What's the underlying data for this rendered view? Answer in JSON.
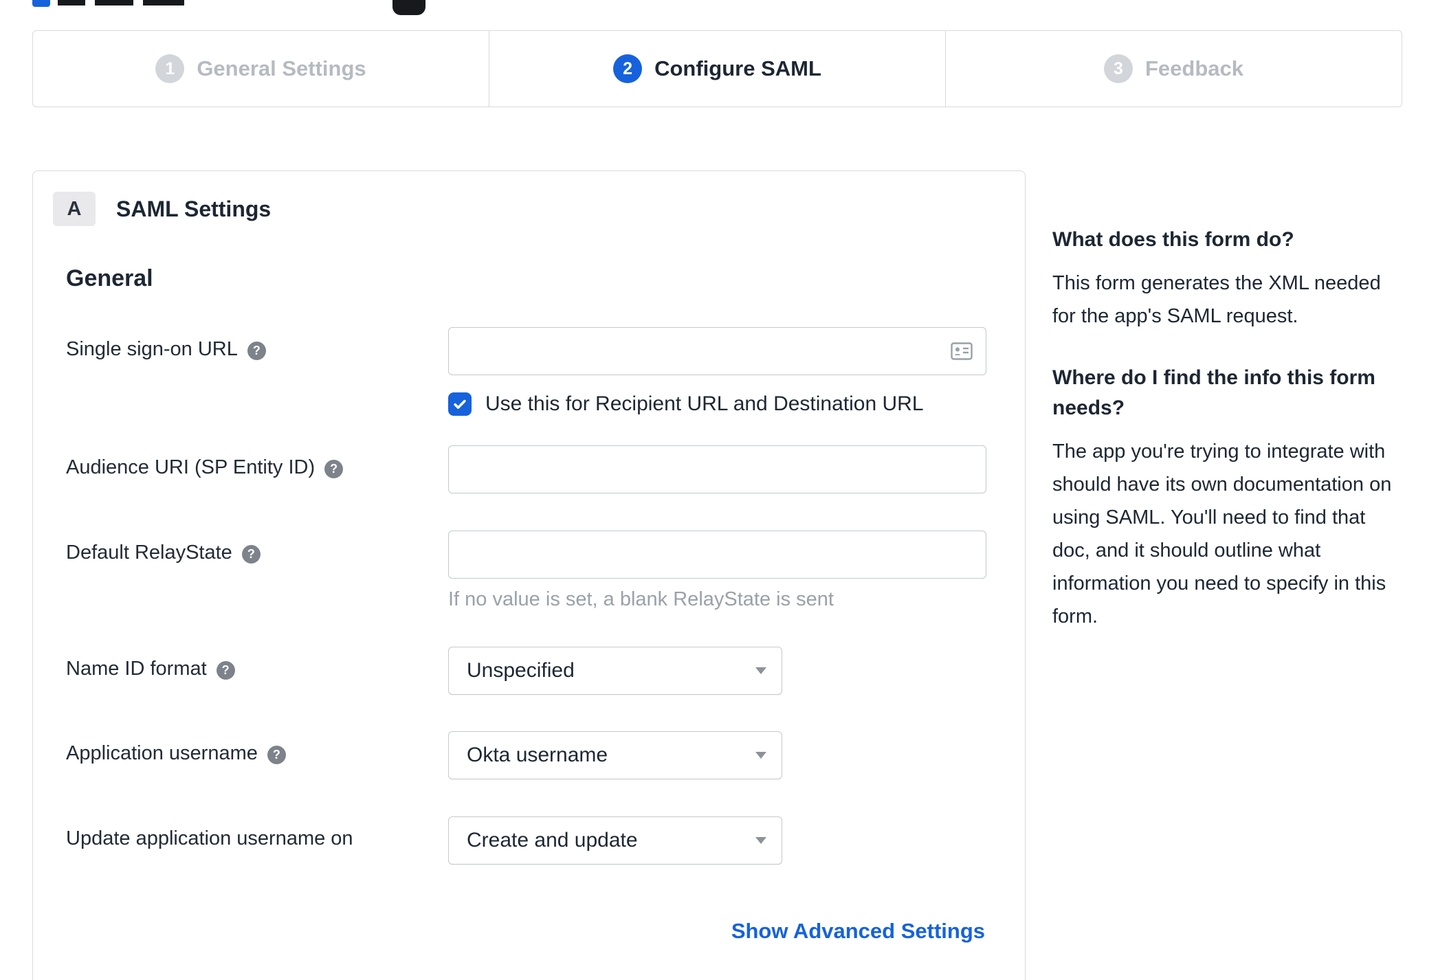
{
  "colors": {
    "accent": "#1662dd",
    "link": "#1662dd",
    "inactive_step": "#d2d5d9"
  },
  "icons": {
    "help_glyph": "?",
    "input_icon": "contact-card-icon"
  },
  "stepper": {
    "steps": [
      {
        "number": "1",
        "label": "General Settings",
        "active": false
      },
      {
        "number": "2",
        "label": "Configure SAML",
        "active": true
      },
      {
        "number": "3",
        "label": "Feedback",
        "active": false
      }
    ]
  },
  "panel": {
    "badge": "A",
    "title": "SAML Settings",
    "section": "General",
    "fields": [
      {
        "label": "Single sign-on URL",
        "value": "",
        "checkbox_label": "Use this for Recipient URL and Destination URL",
        "checkbox_checked": true
      },
      {
        "label": "Audience URI (SP Entity ID)",
        "value": ""
      },
      {
        "label": "Default RelayState",
        "value": "",
        "hint": "If no value is set, a blank RelayState is sent"
      },
      {
        "label": "Name ID format",
        "value": "Unspecified"
      },
      {
        "label": "Application username",
        "value": "Okta username"
      },
      {
        "label": "Update application username on",
        "value": "Create and update"
      }
    ],
    "advanced_link": "Show Advanced Settings"
  },
  "sidebar": {
    "heading1": "What does this form do?",
    "para1": "This form generates the XML needed for the app's SAML request.",
    "heading2": "Where do I find the info this form needs?",
    "para2": "The app you're trying to integrate with should have its own documentation on using SAML. You'll need to find that doc, and it should outline what information you need to specify in this form."
  }
}
